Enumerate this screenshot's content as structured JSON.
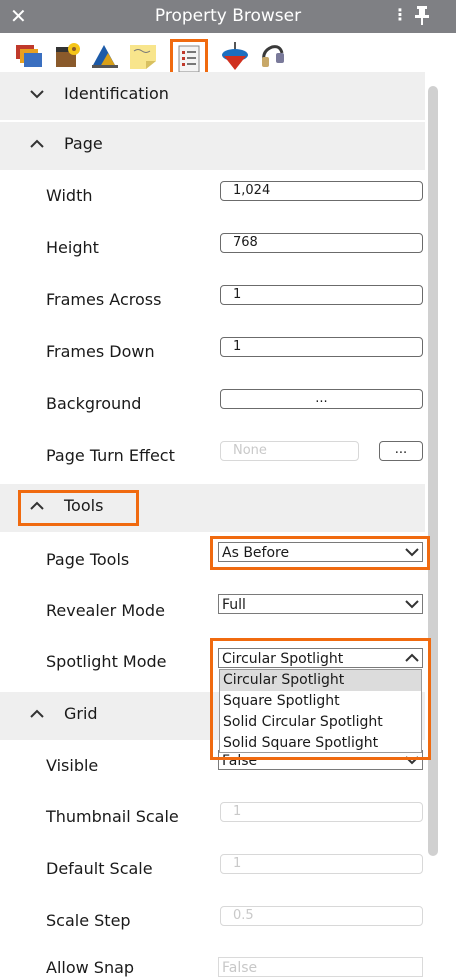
{
  "window": {
    "title": "Property Browser",
    "close_glyph": "✕",
    "menu_glyph": "⋮"
  },
  "toolbar": {
    "icons": [
      "slides-icon",
      "media-icon",
      "animation-icon",
      "notes-icon",
      "page-properties-icon",
      "spinning-top-icon",
      "audio-icon"
    ],
    "active_index": 4,
    "highlight_color": "#f06a0f"
  },
  "sections": {
    "identification": {
      "label": "Identification",
      "expanded": false
    },
    "page": {
      "label": "Page",
      "expanded": true
    },
    "tools": {
      "label": "Tools",
      "expanded": true
    },
    "grid": {
      "label": "Grid",
      "expanded": true
    }
  },
  "page": {
    "width": {
      "label": "Width",
      "value": "1,024"
    },
    "height": {
      "label": "Height",
      "value": "768"
    },
    "frames_across": {
      "label": "Frames Across",
      "value": "1"
    },
    "frames_down": {
      "label": "Frames Down",
      "value": "1"
    },
    "background": {
      "label": "Background",
      "button": "..."
    },
    "page_turn_effect": {
      "label": "Page Turn Effect",
      "value": "None",
      "button": "..."
    }
  },
  "tools": {
    "page_tools": {
      "label": "Page Tools",
      "value": "As Before"
    },
    "revealer_mode": {
      "label": "Revealer Mode",
      "value": "Full"
    },
    "spotlight_mode": {
      "label": "Spotlight Mode",
      "value": "Circular Spotlight",
      "options": [
        "Circular Spotlight",
        "Square Spotlight",
        "Solid Circular Spotlight",
        "Solid Square Spotlight"
      ]
    }
  },
  "grid": {
    "visible": {
      "label": "Visible",
      "value": "False"
    },
    "thumbnail_scale": {
      "label": "Thumbnail Scale",
      "value": "1"
    },
    "default_scale": {
      "label": "Default Scale",
      "value": "1"
    },
    "scale_step": {
      "label": "Scale Step",
      "value": "0.5"
    },
    "allow_snap": {
      "label": "Allow Snap",
      "value": "False"
    }
  }
}
